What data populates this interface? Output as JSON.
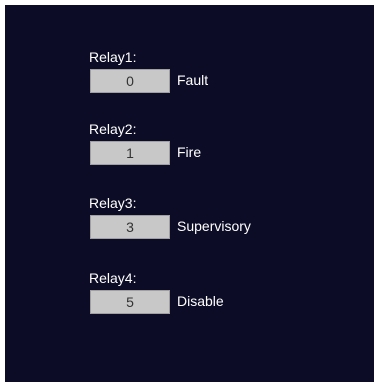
{
  "relays": [
    {
      "label": "Relay1:",
      "value": "0",
      "description": "Fault"
    },
    {
      "label": "Relay2:",
      "value": "1",
      "description": "Fire"
    },
    {
      "label": "Relay3:",
      "value": "3",
      "description": "Supervisory"
    },
    {
      "label": "Relay4:",
      "value": "5",
      "description": "Disable"
    }
  ],
  "colors": {
    "background": "#0c0c26",
    "field": "#c8c8c8",
    "text": "#ffffff"
  }
}
